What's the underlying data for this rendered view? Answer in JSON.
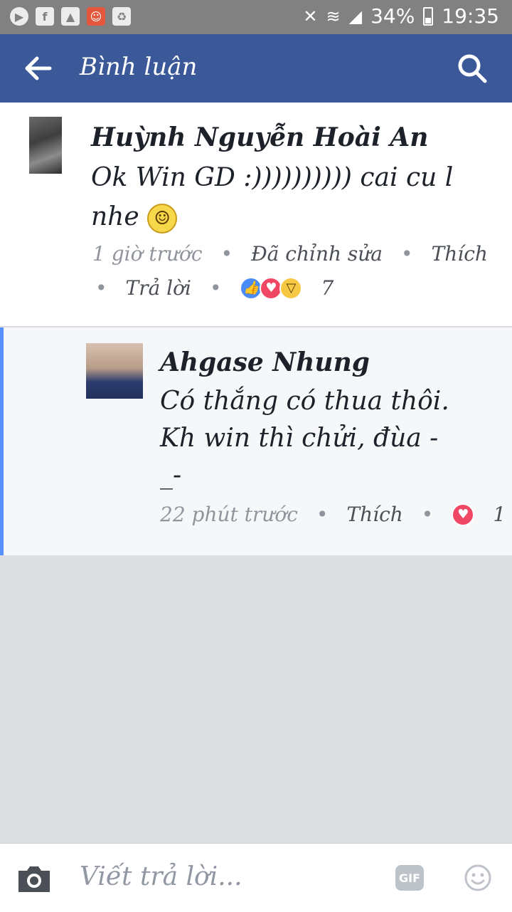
{
  "status_bar": {
    "battery": "34%",
    "time": "19:35",
    "icons": [
      "play-icon",
      "facebook-icon",
      "gallery-icon",
      "app-icon",
      "recycle-icon",
      "mute-icon",
      "wifi-icon",
      "signal-icon",
      "battery-icon"
    ]
  },
  "header": {
    "title": "Bình luận",
    "background": "#3b5998"
  },
  "comment": {
    "author": "Huỳnh Nguyễn Hoài An",
    "text_line1": "Ok Win GD :)))))))))) cai cu l",
    "text_line2": "nhe",
    "emoji": "smile",
    "time": "1 giờ trước",
    "edited": "Đã chỉnh sửa",
    "like": "Thích",
    "reply": "Trả lời",
    "reaction_count": "7",
    "reactions": [
      "like",
      "love",
      "haha"
    ]
  },
  "reply_comment": {
    "author": "Ahgase Nhung",
    "text_line1": "Có thắng có thua thôi.",
    "text_line2": "Kh win thì chửi, đùa -",
    "text_line3": "_-",
    "time": "22 phút trước",
    "like": "Thích",
    "reaction_count": "1",
    "reactions": [
      "love"
    ]
  },
  "composer": {
    "placeholder": "Viết trả lời...",
    "gif_label": "GIF"
  }
}
